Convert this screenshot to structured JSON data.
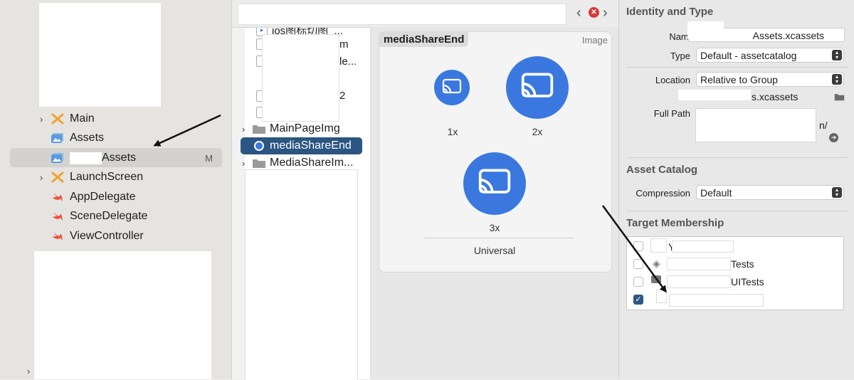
{
  "navigator": {
    "items": [
      {
        "label": "Main",
        "icon": "interface-builder-icon",
        "expandable": true
      },
      {
        "label": "Assets",
        "icon": "asset-catalog-icon",
        "expandable": false
      },
      {
        "label": "Assets",
        "icon": "asset-catalog-icon",
        "expandable": false,
        "selected": true,
        "badge": "M"
      },
      {
        "label": "LaunchScreen",
        "icon": "interface-builder-icon",
        "expandable": true
      },
      {
        "label": "AppDelegate",
        "icon": "swift-file-icon",
        "expandable": false
      },
      {
        "label": "SceneDelegate",
        "icon": "swift-file-icon",
        "expandable": false
      },
      {
        "label": "ViewController",
        "icon": "swift-file-icon",
        "expandable": false
      }
    ]
  },
  "outline": {
    "top_items": [
      "ios图标切图_...",
      "m",
      "le...",
      "2"
    ],
    "items": [
      {
        "label": "MainPageImg",
        "icon": "folder-icon",
        "expandable": true
      },
      {
        "label": "mediaShareEnd",
        "icon": "image-set-icon",
        "expandable": false,
        "selected": true
      },
      {
        "label": "MediaShareIm...",
        "icon": "folder-icon",
        "expandable": true
      }
    ]
  },
  "toolbar": {
    "prev": "‹",
    "next": "›"
  },
  "canvas": {
    "asset_name": "mediaShareEnd",
    "asset_kind": "Image",
    "slots": [
      "1x",
      "2x",
      "3x"
    ],
    "idiom": "Universal"
  },
  "inspector": {
    "identity": {
      "title": "Identity and Type",
      "name_label": "Name",
      "name_value": "Assets.xcassets",
      "type_label": "Type",
      "type_value": "Default - assetcatalog",
      "location_label": "Location",
      "location_value": "Relative to Group",
      "location_path": "s.xcassets",
      "fullpath_label": "Full Path",
      "fullpath_value": "n/"
    },
    "catalog": {
      "title": "Asset Catalog",
      "compression_label": "Compression",
      "compression_value": "Default"
    },
    "membership": {
      "title": "Target Membership",
      "targets": [
        {
          "label": "Y",
          "checked": false
        },
        {
          "label": "Tests",
          "checked": false
        },
        {
          "label": "UITests",
          "checked": false
        },
        {
          "label": "",
          "checked": true
        }
      ]
    }
  },
  "colors": {
    "accent": "#3a78e0",
    "selection": "#2b5582",
    "swift": "#f05138"
  }
}
